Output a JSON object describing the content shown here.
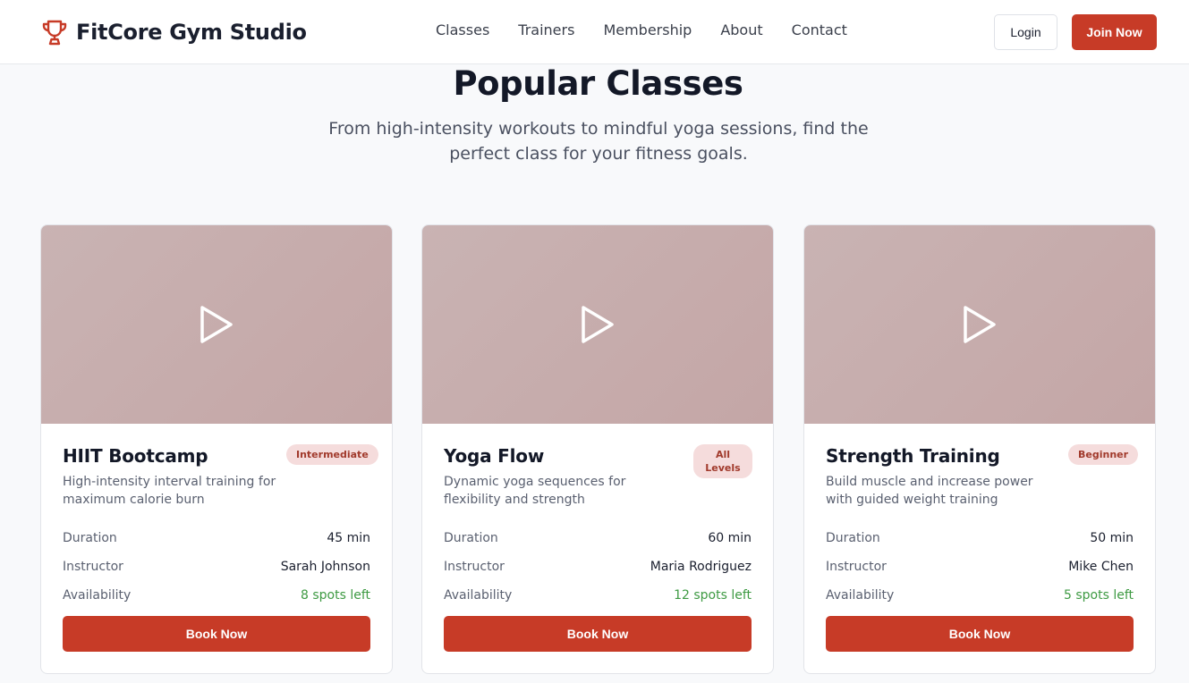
{
  "brand": {
    "name": "FitCore Gym Studio",
    "icon": "trophy-icon"
  },
  "nav": {
    "links": [
      "Classes",
      "Trainers",
      "Membership",
      "About",
      "Contact"
    ],
    "login_label": "Login",
    "join_label": "Join Now"
  },
  "colors": {
    "accent": "#c73b27",
    "availability": "#3e9a43",
    "badge_bg": "#f5dcdc"
  },
  "section": {
    "title": "Popular Classes",
    "subtitle": "From high-intensity workouts to mindful yoga sessions, find the perfect class for your fitness goals."
  },
  "labels": {
    "duration": "Duration",
    "instructor": "Instructor",
    "availability": "Availability",
    "book": "Book Now"
  },
  "classes": [
    {
      "title": "HIIT Bootcamp",
      "badge": "Intermediate",
      "description": "High-intensity interval training for maximum calorie burn",
      "duration": "45 min",
      "instructor": "Sarah Johnson",
      "availability": "8 spots left"
    },
    {
      "title": "Yoga Flow",
      "badge": "All Levels",
      "description": "Dynamic yoga sequences for flexibility and strength",
      "duration": "60 min",
      "instructor": "Maria Rodriguez",
      "availability": "12 spots left"
    },
    {
      "title": "Strength Training",
      "badge": "Beginner",
      "description": "Build muscle and increase power with guided weight training",
      "duration": "50 min",
      "instructor": "Mike Chen",
      "availability": "5 spots left"
    }
  ]
}
